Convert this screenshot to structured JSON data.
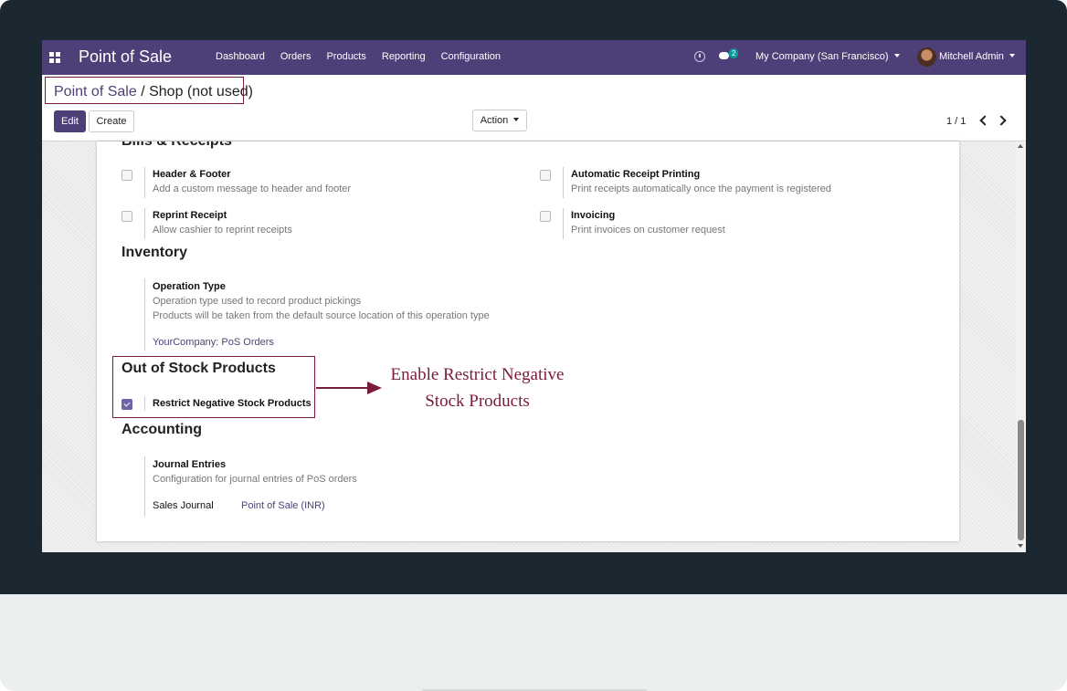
{
  "navbar": {
    "brand": "Point of Sale",
    "menu": [
      "Dashboard",
      "Orders",
      "Products",
      "Reporting",
      "Configuration"
    ],
    "messages_count": "2",
    "company": "My Company (San Francisco)",
    "user": "Mitchell Admin"
  },
  "control_panel": {
    "breadcrumb_parent": "Point of Sale",
    "breadcrumb_separator": "/",
    "breadcrumb_current": "Shop (not used)",
    "edit_label": "Edit",
    "create_label": "Create",
    "action_label": "Action",
    "pager": "1 / 1"
  },
  "form": {
    "bills_title": "Bills & Receipts",
    "header_footer": {
      "label": "Header & Footer",
      "desc": "Add a custom message to header and footer",
      "checked": false
    },
    "auto_print": {
      "label": "Automatic Receipt Printing",
      "desc": "Print receipts automatically once the payment is registered",
      "checked": false
    },
    "reprint": {
      "label": "Reprint Receipt",
      "desc": "Allow cashier to reprint receipts",
      "checked": false
    },
    "invoicing": {
      "label": "Invoicing",
      "desc": "Print invoices on customer request",
      "checked": false
    },
    "inventory_title": "Inventory",
    "operation_type": {
      "label": "Operation Type",
      "desc1": "Operation type used to record product pickings",
      "desc2": "Products will be taken from the default source location of this operation type",
      "value": "YourCompany: PoS Orders"
    },
    "oos_title": "Out of Stock Products",
    "restrict_negative": {
      "label": "Restrict Negative Stock Products",
      "checked": true
    },
    "accounting_title": "Accounting",
    "journal_entries": {
      "label": "Journal Entries",
      "desc": "Configuration for journal entries of PoS orders",
      "sales_journal_label": "Sales Journal",
      "sales_journal_value": "Point of Sale (INR)"
    }
  },
  "annotation": {
    "line1": "Enable Restrict Negative",
    "line2": "Stock Products",
    "color": "#7a1b3e"
  },
  "colors": {
    "brand": "#4f3f78",
    "frame": "#1b2731"
  }
}
